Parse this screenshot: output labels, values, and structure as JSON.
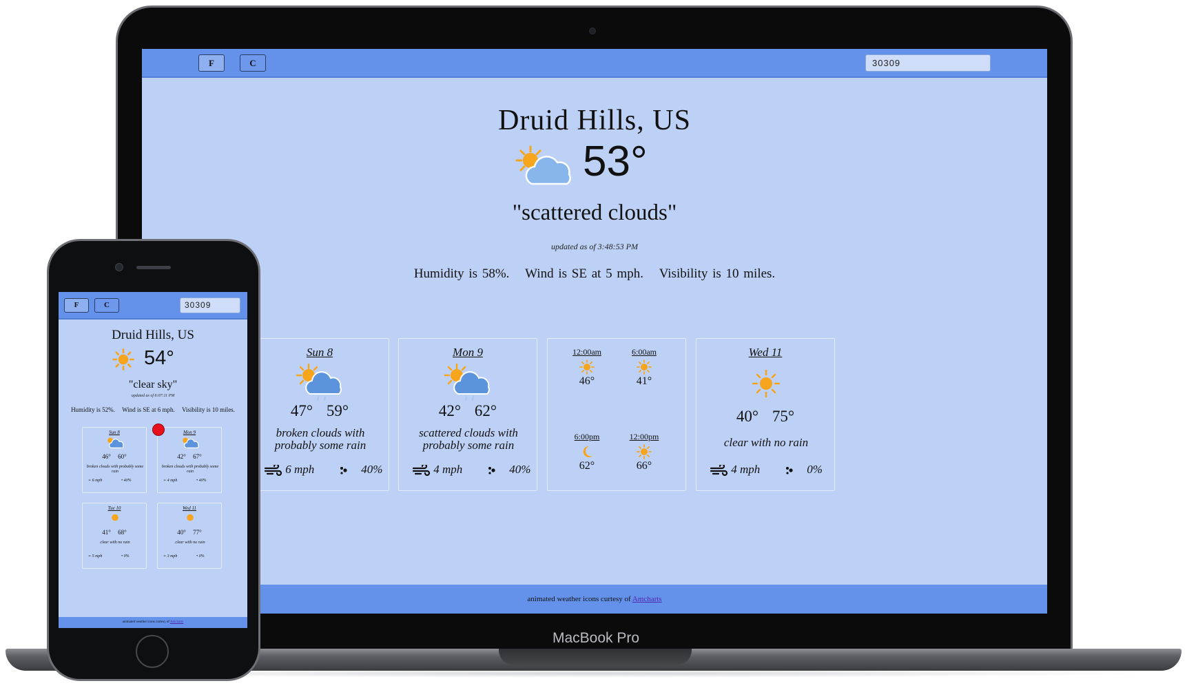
{
  "colors": {
    "screen_bg": "#bdd0f5",
    "bar_bg": "#6492ea",
    "sun": "#f6a51c",
    "cloud": "#7eb2ea",
    "cursor": "#e8101a"
  },
  "device_label": "MacBook Pro",
  "laptop": {
    "toolbar": {
      "f_label": "F",
      "c_label": "C",
      "zip_value": "30309"
    },
    "current": {
      "city": "Druid Hills, US",
      "icon": "partly-cloudy-icon",
      "temp": "53°",
      "description": "\"scattered clouds\"",
      "updated": "updated as of 3:48:53 PM",
      "humidity": "Humidity is 58%.",
      "wind": "Wind is SE at 5 mph.",
      "visibility": "Visibility is 10 miles."
    },
    "forecast": [
      {
        "day": "Sun 8",
        "icon": "cloudy-rain-icon",
        "low": "47°",
        "high": "59°",
        "desc": "broken clouds with probably some rain",
        "wind": "6 mph",
        "rain": "40%"
      },
      {
        "day": "Mon 9",
        "icon": "cloudy-rain-icon",
        "low": "42°",
        "high": "62°",
        "desc": "scattered clouds with probably some rain",
        "wind": "4 mph",
        "rain": "40%"
      },
      {
        "day": "Wed 11",
        "icon": "sun-icon",
        "low": "40°",
        "high": "75°",
        "desc": "clear with no rain",
        "wind": "4 mph",
        "rain": "0%"
      }
    ],
    "hourly": [
      {
        "time": "12:00am",
        "icon": "sun-icon",
        "temp": "46°"
      },
      {
        "time": "6:00am",
        "icon": "sun-icon",
        "temp": "41°"
      },
      {
        "time": "6:00pm",
        "icon": "moon-icon",
        "temp": "62°"
      },
      {
        "time": "12:00pm",
        "icon": "sun-icon",
        "temp": "66°"
      }
    ],
    "footer": {
      "text": "animated weather icons curtesy of ",
      "link": "Amcharts"
    }
  },
  "phone": {
    "toolbar": {
      "f_label": "F",
      "c_label": "C",
      "zip_value": "30309"
    },
    "current": {
      "city": "Druid Hills, US",
      "icon": "sun-icon",
      "temp": "54°",
      "description": "\"clear sky\"",
      "updated": "updated as of 6:07:11 PM",
      "humidity": "Humidity is 52%.",
      "wind": "Wind is SE at 6 mph.",
      "visibility": "Visibility is 10 miles."
    },
    "forecast": [
      {
        "day": "Sun 8",
        "icon": "cloudy-rain-icon",
        "low": "46°",
        "high": "60°",
        "desc": "broken clouds with probably some rain",
        "wind": "6 mph",
        "rain": "40%"
      },
      {
        "day": "Mon 9",
        "icon": "cloudy-rain-icon",
        "low": "42°",
        "high": "67°",
        "desc": "broken clouds with probably some rain",
        "wind": "4 mph",
        "rain": "40%"
      },
      {
        "day": "Tue 10",
        "icon": "sun-icon",
        "low": "41°",
        "high": "68°",
        "desc": "clear with no rain",
        "wind": "5 mph",
        "rain": "0%"
      },
      {
        "day": "Wed 11",
        "icon": "sun-icon",
        "low": "40°",
        "high": "77°",
        "desc": "clear with no rain",
        "wind": "3 mph",
        "rain": "0%"
      }
    ],
    "footer": {
      "text": "animated weather icons curtesy of ",
      "link": "Amcharts"
    }
  }
}
